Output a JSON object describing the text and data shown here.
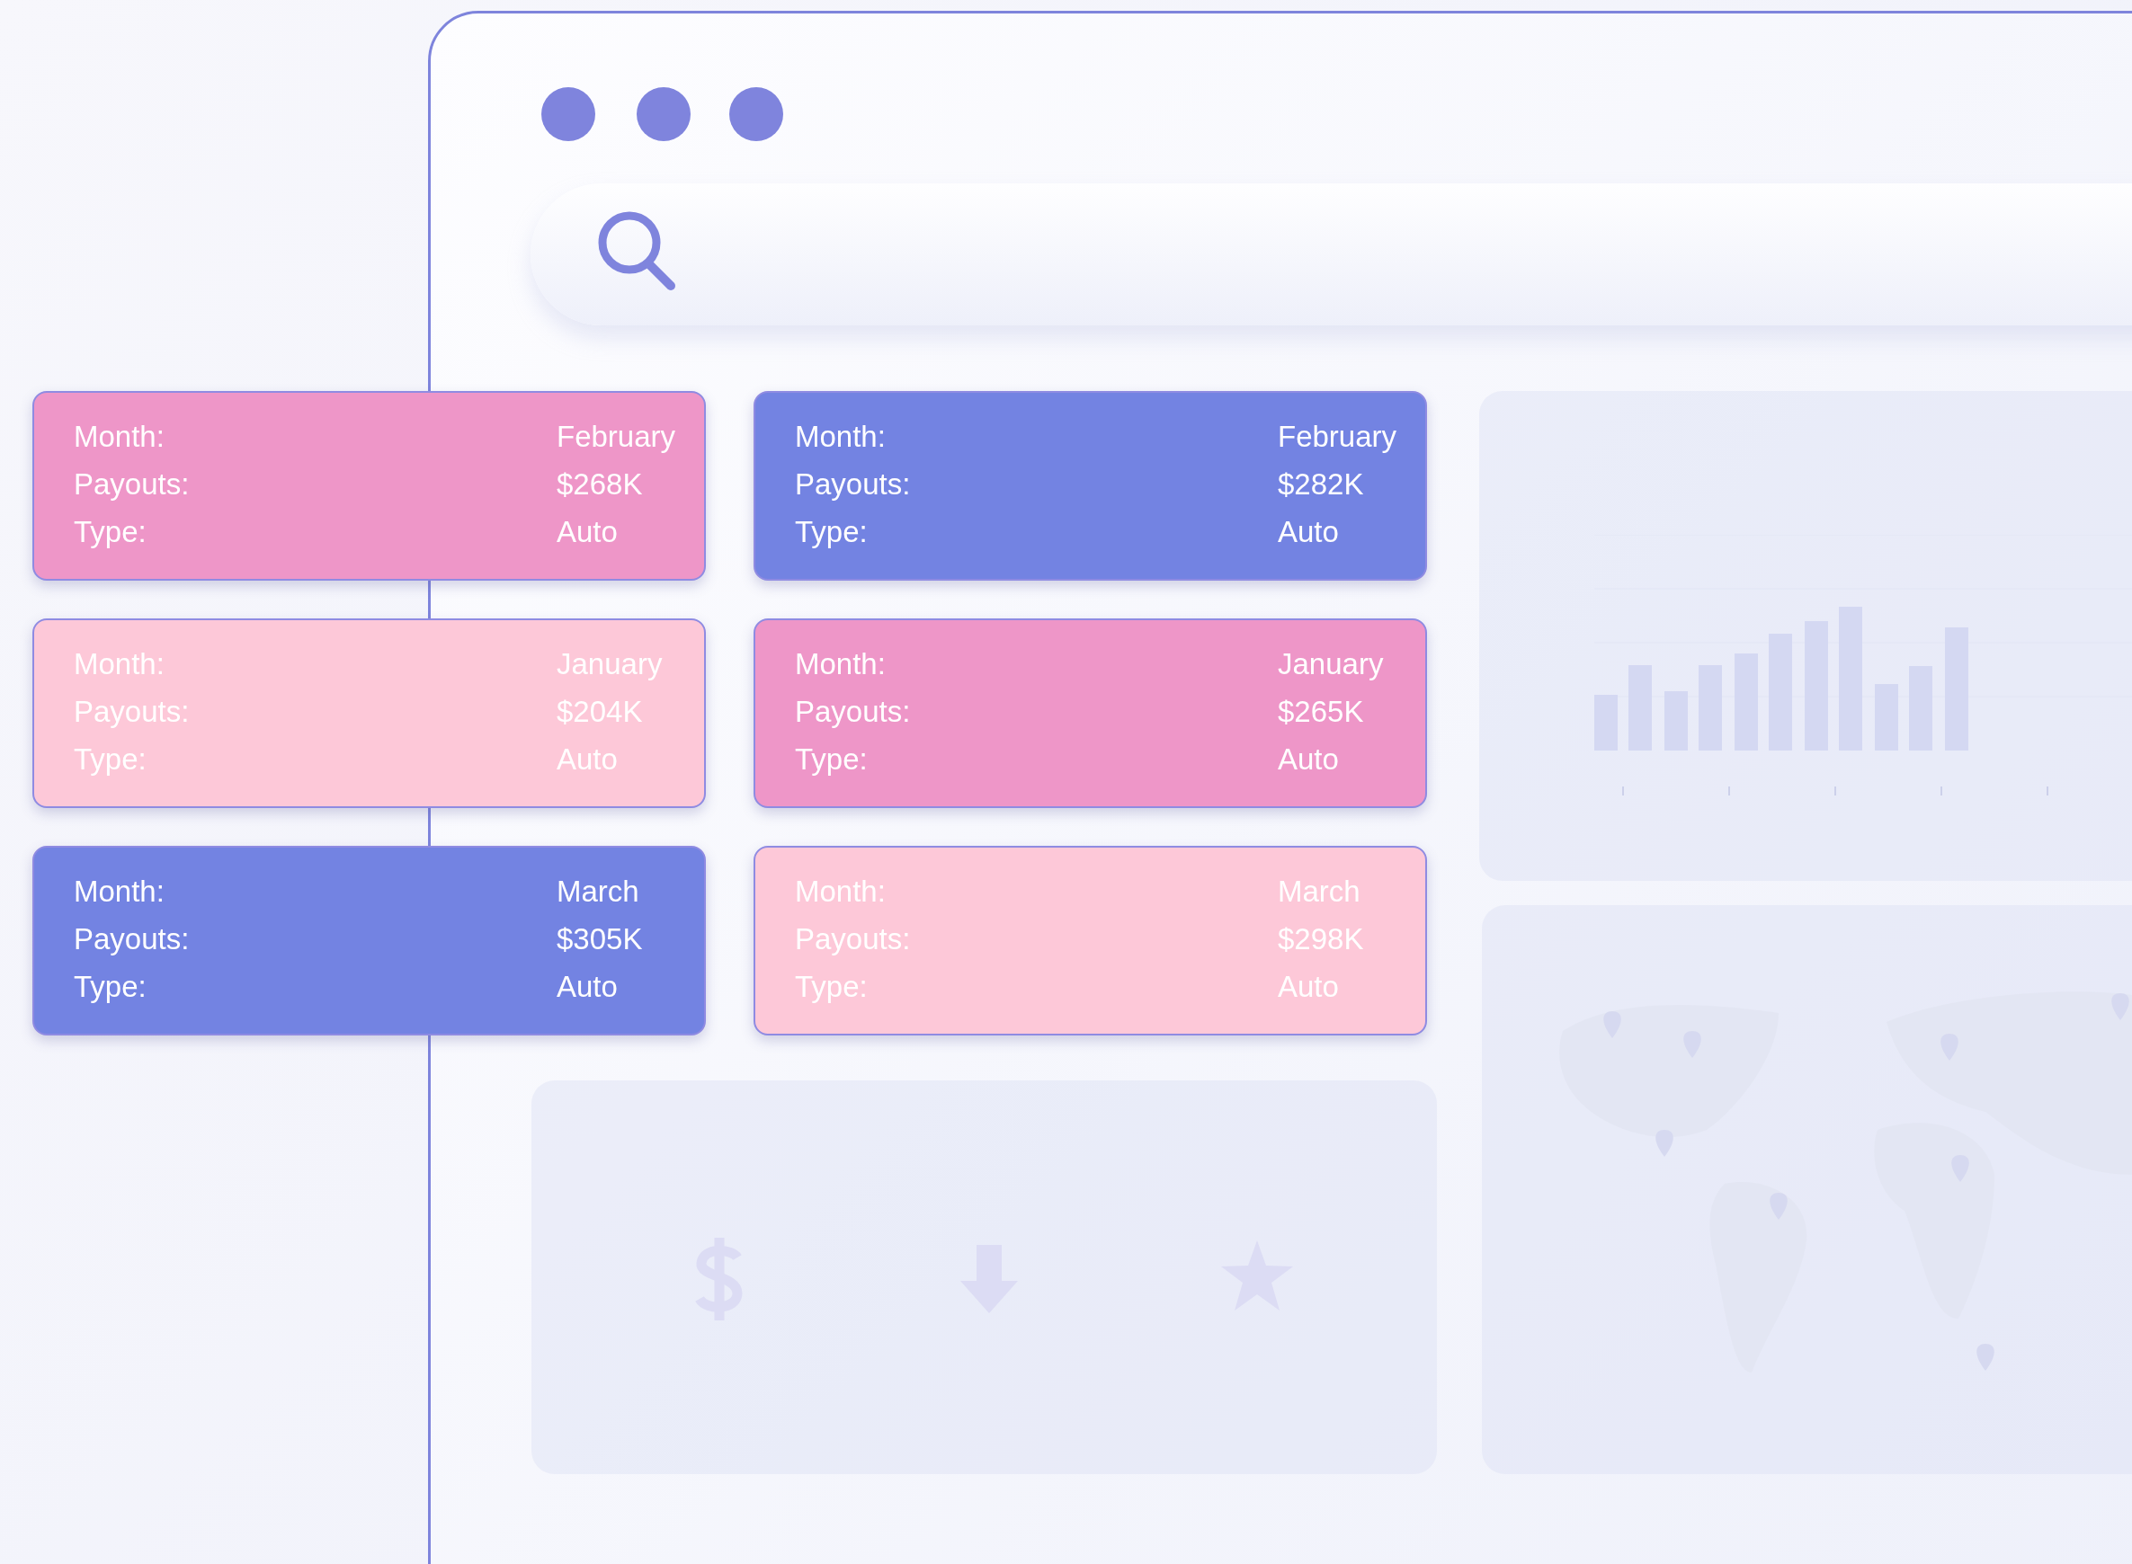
{
  "cards": [
    {
      "color": "#ee96c8",
      "rows": [
        {
          "label": "Month:",
          "value": "February"
        },
        {
          "label": "Payouts:",
          "value": "$268K"
        },
        {
          "label": "Type:",
          "value": "Auto"
        }
      ]
    },
    {
      "color": "#7383e2",
      "rows": [
        {
          "label": "Month:",
          "value": "February"
        },
        {
          "label": "Payouts:",
          "value": "$282K"
        },
        {
          "label": "Type:",
          "value": "Auto"
        }
      ]
    },
    {
      "color": "#fdc8d8",
      "rows": [
        {
          "label": "Month:",
          "value": "January"
        },
        {
          "label": "Payouts:",
          "value": "$204K"
        },
        {
          "label": "Type:",
          "value": "Auto"
        }
      ]
    },
    {
      "color": "#ee96c8",
      "rows": [
        {
          "label": "Month:",
          "value": "January"
        },
        {
          "label": "Payouts:",
          "value": "$265K"
        },
        {
          "label": "Type:",
          "value": "Auto"
        }
      ]
    },
    {
      "color": "#7383e2",
      "rows": [
        {
          "label": "Month:",
          "value": "March"
        },
        {
          "label": "Payouts:",
          "value": "$305K"
        },
        {
          "label": "Type:",
          "value": "Auto"
        }
      ]
    },
    {
      "color": "#fdc8d8",
      "rows": [
        {
          "label": "Month:",
          "value": "March"
        },
        {
          "label": "Payouts:",
          "value": "$298K"
        },
        {
          "label": "Type:",
          "value": "Auto"
        }
      ]
    }
  ]
}
